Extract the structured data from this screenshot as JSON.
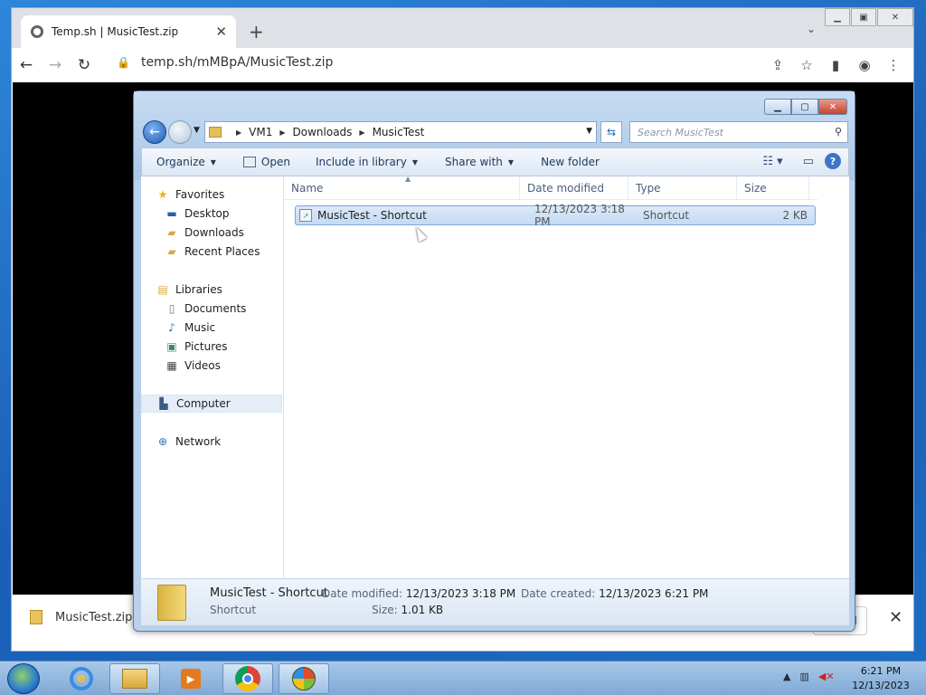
{
  "browser": {
    "tab_title": "Temp.sh | MusicTest.zip",
    "url": "temp.sh/mMBpA/MusicTest.zip"
  },
  "download_bar": {
    "file_name": "MusicTest.zip",
    "show_all": "all"
  },
  "explorer": {
    "address": [
      "VM1",
      "Downloads",
      "MusicTest"
    ],
    "search_placeholder": "Search MusicTest",
    "commands": {
      "organize": "Organize",
      "open": "Open",
      "include": "Include in library",
      "share": "Share with",
      "new_folder": "New folder"
    },
    "nav": {
      "favorites": "Favorites",
      "desktop": "Desktop",
      "downloads": "Downloads",
      "recent": "Recent Places",
      "libraries": "Libraries",
      "documents": "Documents",
      "music": "Music",
      "pictures": "Pictures",
      "videos": "Videos",
      "computer": "Computer",
      "network": "Network"
    },
    "columns": {
      "name": "Name",
      "date": "Date modified",
      "type": "Type",
      "size": "Size"
    },
    "files": [
      {
        "name": "MusicTest - Shortcut",
        "date": "12/13/2023 3:18 PM",
        "type": "Shortcut",
        "size": "2 KB"
      }
    ],
    "details": {
      "name": "MusicTest - Shortcut",
      "type": "Shortcut",
      "modified_label": "Date modified:",
      "modified": "12/13/2023 3:18 PM",
      "size_label": "Size:",
      "size": "1.01 KB",
      "created_label": "Date created:",
      "created": "12/13/2023 6:21 PM"
    }
  },
  "taskbar": {
    "time": "6:21 PM",
    "date": "12/13/2023"
  }
}
